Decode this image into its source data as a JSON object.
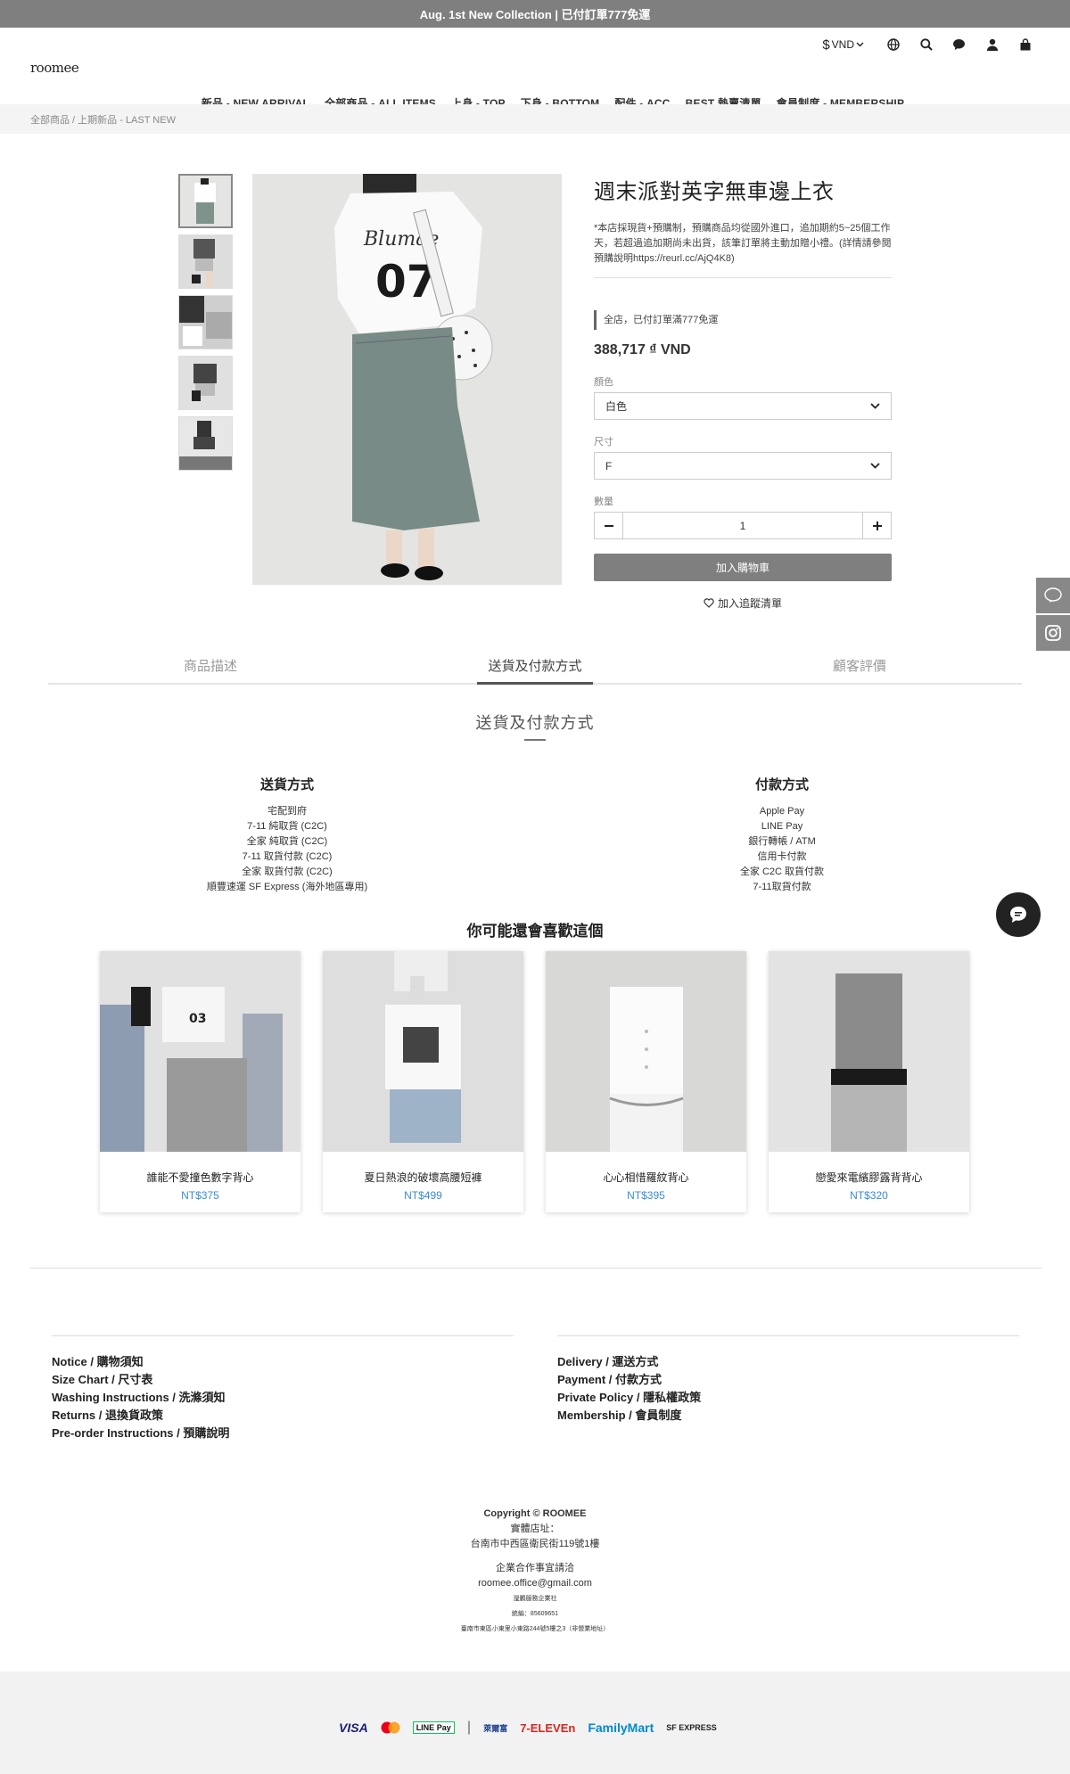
{
  "announcement": "Aug. 1st New Collection | 已付訂單777免運",
  "brand": "roomee",
  "currency": "VND",
  "currency_symbol": "$",
  "nav": [
    "新品 - NEW ARRIVAL",
    "全部商品 - ALL ITEMS",
    "上身 - TOP",
    "下身 - BOTTOM",
    "配件 - ACC",
    "BEST 熱賣清單",
    "會員制度 - MEMBERSHIP"
  ],
  "breadcrumb": "全部商品 / 上期新品 - LAST NEW",
  "product": {
    "title": "週末派對英字無車邊上衣",
    "description": "*本店採現貨+預購制，預購商品均從國外進口，追加期約5~25個工作天，若超過追加期尚未出貨，該筆訂單將主動加贈小禮。(詳情請參閱預購說明https://reurl.cc/AjQ4K8)",
    "promo": "全店，已付訂單滿777免運",
    "price": "388,717 ₫ VND",
    "color_label": "顏色",
    "color_value": "白色",
    "size_label": "尺寸",
    "size_value": "F",
    "qty_label": "數量",
    "qty_value": "1",
    "add_to_cart": "加入購物車",
    "wishlist": "加入追蹤清單"
  },
  "tabs": [
    "商品描述",
    "送貨及付款方式",
    "顧客評價"
  ],
  "shipping_heading": "送貨及付款方式",
  "shipping": {
    "title": "送貨方式",
    "items": [
      "宅配到府",
      "7-11 純取貨 (C2C)",
      "全家 純取貨 (C2C)",
      "7-11 取貨付款 (C2C)",
      "全家 取貨付款 (C2C)",
      "順豐速運 SF Express (海外地區專用)"
    ]
  },
  "payment": {
    "title": "付款方式",
    "items": [
      "Apple Pay",
      "LINE Pay",
      "銀行轉帳 / ATM",
      "信用卡付款",
      "全家 C2C 取貨付款",
      "7-11取貨付款"
    ]
  },
  "also_like": "你可能還會喜歡這個",
  "related": [
    {
      "name": "誰能不愛撞色數字背心",
      "price": "NT$375"
    },
    {
      "name": "夏日熱浪的破壞高腰短褲",
      "price": "NT$499"
    },
    {
      "name": "心心相惜羅紋背心",
      "price": "NT$395"
    },
    {
      "name": "戀愛來電繽膠露背背心",
      "price": "NT$320"
    }
  ],
  "footer_links_left": [
    "Notice / 購物須知",
    "Size Chart / 尺寸表",
    "Washing Instructions / 洗滌須知",
    "Returns / 退換貨政策",
    "Pre-order Instructions / 預購說明"
  ],
  "footer_links_right": [
    "Delivery / 運送方式",
    "Payment / 付款方式",
    "Private Policy / 隱私權政策",
    "Membership / 會員制度"
  ],
  "copyright": "Copyright © ROOMEE",
  "store_label": "實體店址：",
  "store_address": "台南市中西區衛民街119號1樓",
  "biz_label": "企業合作事宜請洽",
  "email": "roomee.office@gmail.com",
  "company": "瀅鵬服務企業社",
  "tax_id": "統編：85609651",
  "reg_address": "臺南市東區小東里小東路244號5樓之3（非營業地址）",
  "payment_logos": {
    "visa": "VISA",
    "linepay": "LINE Pay",
    "seven": "7-ELEVEn",
    "familymart": "FamilyMart",
    "hilife": "萊爾富",
    "sf": "SF EXPRESS"
  },
  "colors": {
    "accent_gray": "#7f7f7f",
    "price_blue": "#3a8bd9"
  }
}
